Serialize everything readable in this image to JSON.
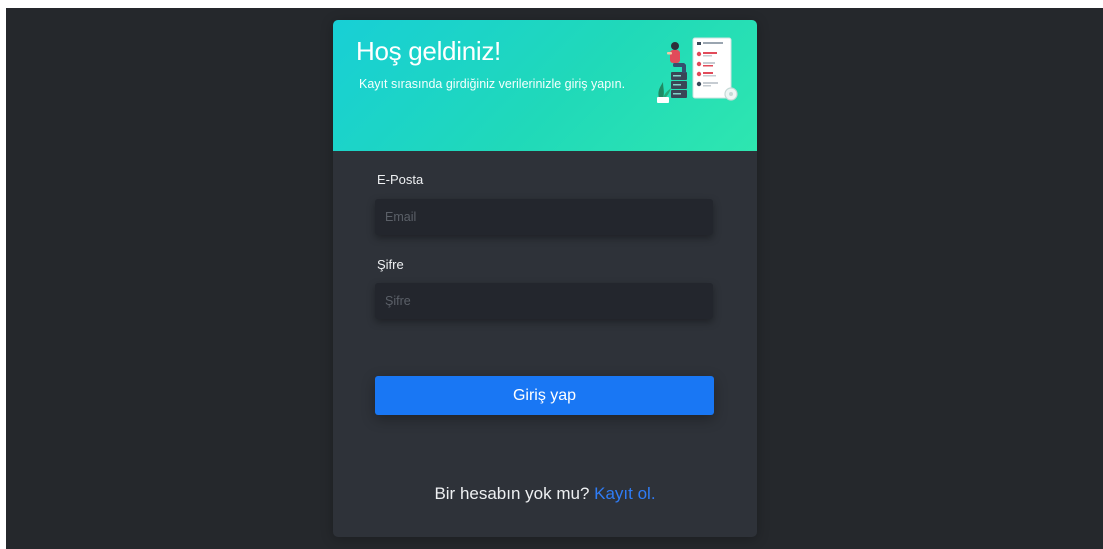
{
  "header": {
    "title": "Hoş geldiniz!",
    "subtitle": "Kayıt sırasında girdiğiniz verilerinizle giriş yapın."
  },
  "form": {
    "email_label": "E-Posta",
    "email_placeholder": "Email",
    "email_value": "",
    "password_label": "Şifre",
    "password_placeholder": "Şifre",
    "password_value": "",
    "submit_label": "Giriş yap"
  },
  "footer": {
    "prompt": "Bir hesabın yok mu?",
    "register_link": "Kayıt ol."
  },
  "colors": {
    "page_background": "#25282c",
    "card_background": "#2e3239",
    "header_gradient_start": "#18cfd6",
    "header_gradient_end": "#2ee6b0",
    "input_background": "#23262d",
    "primary_button": "#1977f4",
    "link": "#2f7cf6"
  },
  "icons": {
    "header_illustration": "person-with-server-and-checklist-illustration"
  }
}
